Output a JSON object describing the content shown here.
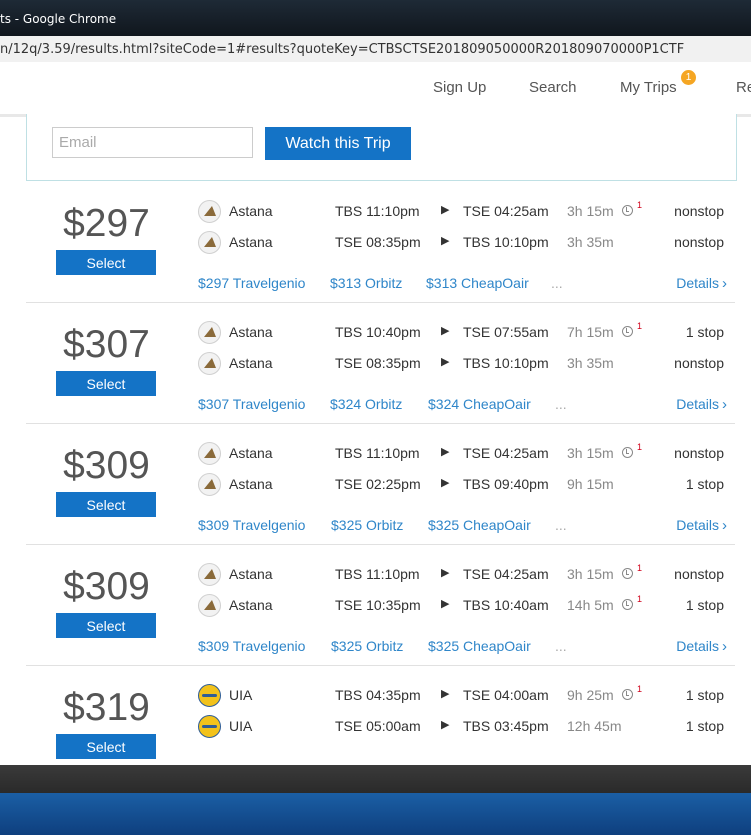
{
  "window": {
    "title": "ts - Google Chrome"
  },
  "browser": {
    "url": "n/12q/3.59/results.html?siteCode=1#results?quoteKey=CTBSCTSE201809050000R201809070000P1CTF"
  },
  "nav": {
    "sign_up": "Sign Up",
    "search": "Search",
    "my_trips": "My Trips",
    "my_trips_badge": "1",
    "cut_link": "Re"
  },
  "watch": {
    "email_placeholder": "Email",
    "button_label": "Watch this Trip"
  },
  "select_label": "Select",
  "details_label": "Details",
  "more_label": "...",
  "results": [
    {
      "price": "$297",
      "legs": [
        {
          "airline": "Astana",
          "logo": "astana",
          "dep": "TBS 11:10pm",
          "arr": "TSE 04:25am",
          "duration": "3h 15m",
          "layover": "1",
          "stops": "nonstop"
        },
        {
          "airline": "Astana",
          "logo": "astana",
          "dep": "TSE 08:35pm",
          "arr": "TBS 10:10pm",
          "duration": "3h 35m",
          "layover": "",
          "stops": "nonstop"
        }
      ],
      "providers": [
        "$297  Travelgenio",
        "$313  Orbitz",
        "$313  CheapOair"
      ]
    },
    {
      "price": "$307",
      "legs": [
        {
          "airline": "Astana",
          "logo": "astana",
          "dep": "TBS 10:40pm",
          "arr": "TSE 07:55am",
          "duration": "7h 15m",
          "layover": "1",
          "stops": "1 stop"
        },
        {
          "airline": "Astana",
          "logo": "astana",
          "dep": "TSE 08:35pm",
          "arr": "TBS 10:10pm",
          "duration": "3h 35m",
          "layover": "",
          "stops": "nonstop"
        }
      ],
      "providers": [
        "$307  Travelgenio",
        "$324  Orbitz",
        "$324  CheapOair"
      ]
    },
    {
      "price": "$309",
      "legs": [
        {
          "airline": "Astana",
          "logo": "astana",
          "dep": "TBS 11:10pm",
          "arr": "TSE 04:25am",
          "duration": "3h 15m",
          "layover": "1",
          "stops": "nonstop"
        },
        {
          "airline": "Astana",
          "logo": "astana",
          "dep": "TSE 02:25pm",
          "arr": "TBS 09:40pm",
          "duration": "9h 15m",
          "layover": "",
          "stops": "1 stop"
        }
      ],
      "providers": [
        "$309  Travelgenio",
        "$325  Orbitz",
        "$325  CheapOair"
      ]
    },
    {
      "price": "$309",
      "legs": [
        {
          "airline": "Astana",
          "logo": "astana",
          "dep": "TBS 11:10pm",
          "arr": "TSE 04:25am",
          "duration": "3h 15m",
          "layover": "1",
          "stops": "nonstop"
        },
        {
          "airline": "Astana",
          "logo": "astana",
          "dep": "TSE 10:35pm",
          "arr": "TBS 10:40am",
          "duration": "14h 5m",
          "layover": "1",
          "stops": "1 stop"
        }
      ],
      "providers": [
        "$309  Travelgenio",
        "$325  Orbitz",
        "$325  CheapOair"
      ]
    },
    {
      "price": "$319",
      "legs": [
        {
          "airline": "UIA",
          "logo": "uia",
          "dep": "TBS 04:35pm",
          "arr": "TSE 04:00am",
          "duration": "9h 25m",
          "layover": "1",
          "stops": "1 stop"
        },
        {
          "airline": "UIA",
          "logo": "uia",
          "dep": "TSE 05:00am",
          "arr": "TBS 03:45pm",
          "duration": "12h 45m",
          "layover": "",
          "stops": "1 stop"
        }
      ],
      "providers": [
        "",
        "",
        ""
      ]
    }
  ]
}
